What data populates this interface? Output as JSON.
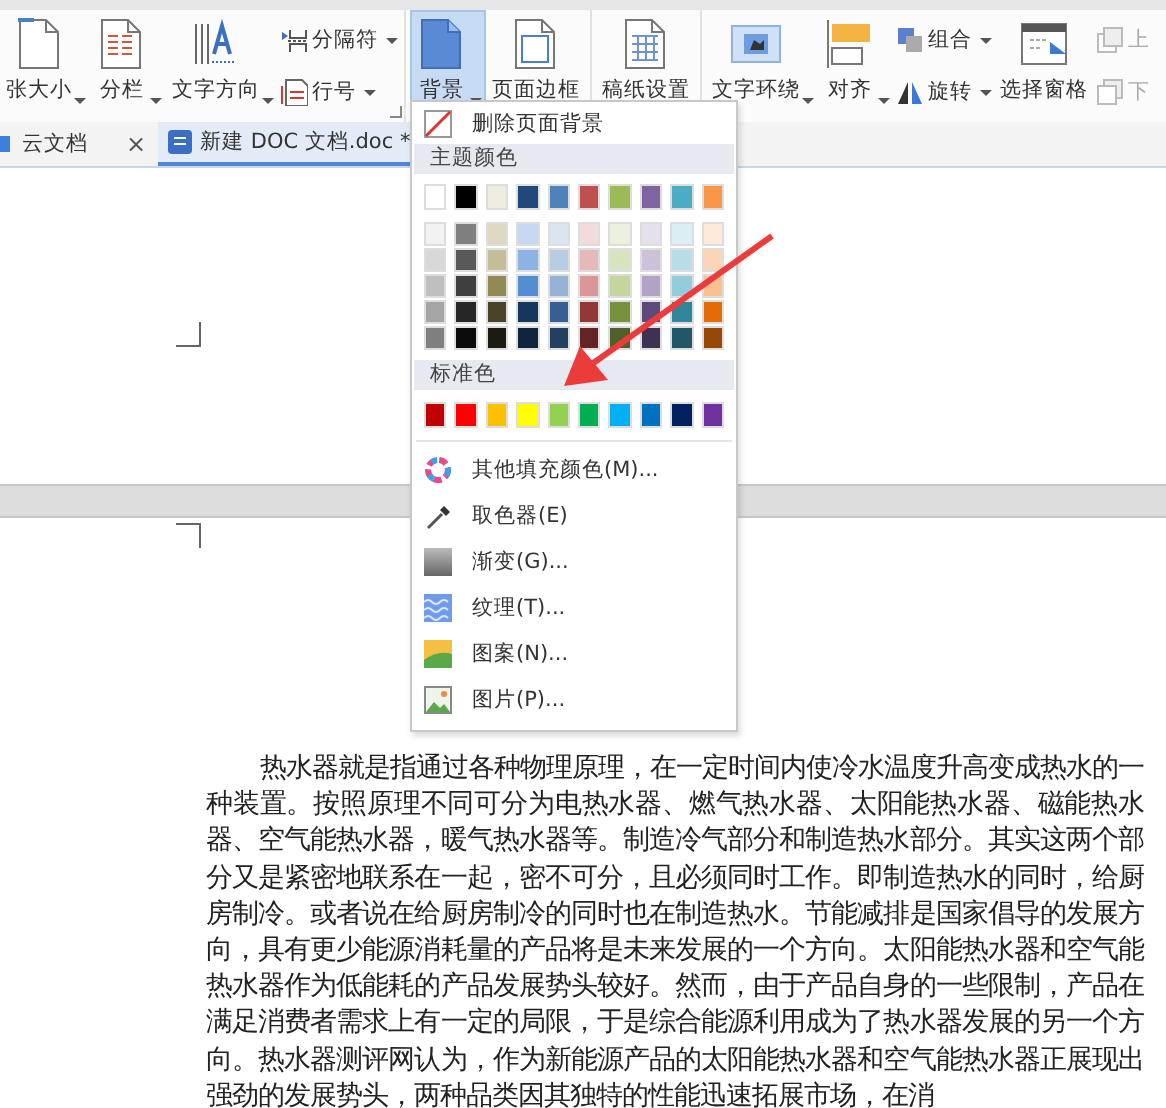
{
  "ribbon": {
    "groups": [
      {
        "items": [
          {
            "kind": "large",
            "label": "张大小",
            "dropdown": true,
            "selected": false
          },
          {
            "kind": "large",
            "label": "分栏",
            "dropdown": true,
            "selected": false
          },
          {
            "kind": "large",
            "label": "文字方向",
            "dropdown": true,
            "selected": false
          },
          {
            "kind": "pair",
            "items": [
              {
                "label": "分隔符",
                "dropdown": true,
                "disabled": false
              },
              {
                "label": "行号",
                "dropdown": true,
                "disabled": false
              }
            ]
          }
        ],
        "launcher": true
      },
      {
        "items": [
          {
            "kind": "large",
            "label": "背景",
            "dropdown": true,
            "selected": true
          },
          {
            "kind": "large",
            "label": "页面边框",
            "dropdown": false,
            "selected": false
          }
        ]
      },
      {
        "items": [
          {
            "kind": "large",
            "label": "稿纸设置",
            "dropdown": false,
            "selected": false
          }
        ]
      },
      {
        "items": [
          {
            "kind": "large",
            "label": "文字环绕",
            "dropdown": true,
            "selected": false
          },
          {
            "kind": "large",
            "label": "对齐",
            "dropdown": true,
            "selected": false
          },
          {
            "kind": "pair",
            "items": [
              {
                "label": "组合",
                "dropdown": true,
                "disabled": false
              },
              {
                "label": "旋转",
                "dropdown": true,
                "disabled": false
              }
            ]
          },
          {
            "kind": "large",
            "label": "选择窗格",
            "dropdown": false,
            "selected": false
          },
          {
            "kind": "pair",
            "items": [
              {
                "label": "上",
                "dropdown": false,
                "disabled": true
              },
              {
                "label": "下",
                "dropdown": false,
                "disabled": true
              }
            ]
          }
        ]
      }
    ]
  },
  "tabs": [
    {
      "label": "云文档",
      "close": "×",
      "selected": false
    },
    {
      "label": "新建 DOC 文档.doc *",
      "selected": true
    }
  ],
  "document": {
    "paragraph": "热水器就是指通过各种物理原理，在一定时间内使冷水温度升高变成热水的一种装置。按照原理不同可分为电热水器、燃气热水器、太阳能热水器、磁能热水器、空气能热水器，暖气热水器等。制造冷气部分和制造热水部分。其实这两个部分又是紧密地联系在一起，密不可分，且必须同时工作。即制造热水的同时，给厨房制冷。或者说在给厨房制冷的同时也在制造热水。节能减排是国家倡导的发展方向，具有更少能源消耗量的产品将是未来发展的一个方向。太阳能热水器和空气能热水器作为低能耗的产品发展势头较好。然而，由于产品自身的一些限制，产品在满足消费者需求上有一定的局限，于是综合能源利用成为了热水器发展的另一个方向。热水器测评网认为，作为新能源产品的太阳能热水器和空气能热水器正展现出强劲的发展势头，两种品类因其独特的性能迅速拓展市场，在消"
  },
  "menu": {
    "remove_action": "删除页面背景",
    "theme_header": "主题颜色",
    "theme_colors": [
      {
        "color": "#ffffff"
      },
      {
        "color": "#000000"
      },
      {
        "color": "#eeece1"
      },
      {
        "color": "#1f497d"
      },
      {
        "color": "#4f81bd"
      },
      {
        "color": "#c0504d"
      },
      {
        "color": "#9bbb59"
      },
      {
        "color": "#8064a2"
      },
      {
        "color": "#4bacc6"
      },
      {
        "color": "#f79646"
      }
    ],
    "theme_shades": [
      [
        {
          "color": "#f2f2f2"
        },
        {
          "color": "#7f7f7f"
        },
        {
          "color": "#ddd9c3"
        },
        {
          "color": "#c6d9f0"
        },
        {
          "color": "#dbe5f1"
        },
        {
          "color": "#f2dcdb"
        },
        {
          "color": "#ebf1dd"
        },
        {
          "color": "#e5e0ec"
        },
        {
          "color": "#dbeef3"
        },
        {
          "color": "#fdeada"
        }
      ],
      [
        {
          "color": "#d8d8d8"
        },
        {
          "color": "#595959"
        },
        {
          "color": "#c4bd97"
        },
        {
          "color": "#8db3e2"
        },
        {
          "color": "#b8cce4"
        },
        {
          "color": "#e5b9b7"
        },
        {
          "color": "#d7e3bc"
        },
        {
          "color": "#ccc1d9"
        },
        {
          "color": "#b7dde8"
        },
        {
          "color": "#fbd5b5"
        }
      ],
      [
        {
          "color": "#bfbfbf"
        },
        {
          "color": "#3f3f3f"
        },
        {
          "color": "#938953"
        },
        {
          "color": "#548dd4"
        },
        {
          "color": "#95b3d7"
        },
        {
          "color": "#d99694"
        },
        {
          "color": "#c3d69b"
        },
        {
          "color": "#b2a2c7"
        },
        {
          "color": "#92cddc"
        },
        {
          "color": "#fac08f"
        }
      ],
      [
        {
          "color": "#a5a5a5"
        },
        {
          "color": "#262626"
        },
        {
          "color": "#494429"
        },
        {
          "color": "#17365d"
        },
        {
          "color": "#366092"
        },
        {
          "color": "#953734"
        },
        {
          "color": "#76923c"
        },
        {
          "color": "#5f497a"
        },
        {
          "color": "#31859b"
        },
        {
          "color": "#e36c09"
        }
      ],
      [
        {
          "color": "#7f7f7f"
        },
        {
          "color": "#0c0c0c"
        },
        {
          "color": "#1d1b10"
        },
        {
          "color": "#0f243e"
        },
        {
          "color": "#244061"
        },
        {
          "color": "#632423"
        },
        {
          "color": "#4f6128"
        },
        {
          "color": "#3f3151"
        },
        {
          "color": "#205867"
        },
        {
          "color": "#974806"
        }
      ]
    ],
    "standard_header": "标准色",
    "standard_colors": [
      {
        "color": "#c00000"
      },
      {
        "color": "#ff0000"
      },
      {
        "color": "#ffc000"
      },
      {
        "color": "#ffff00"
      },
      {
        "color": "#92d050"
      },
      {
        "color": "#00b050"
      },
      {
        "color": "#00b0f0"
      },
      {
        "color": "#0070c0"
      },
      {
        "color": "#002060"
      },
      {
        "color": "#7030a0"
      }
    ],
    "actions": [
      {
        "label": "其他填充颜色(M)..."
      },
      {
        "label": "取色器(E)"
      },
      {
        "label": "渐变(G)..."
      },
      {
        "label": "纹理(T)..."
      },
      {
        "label": "图案(N)..."
      },
      {
        "label": "图片(P)..."
      }
    ]
  }
}
